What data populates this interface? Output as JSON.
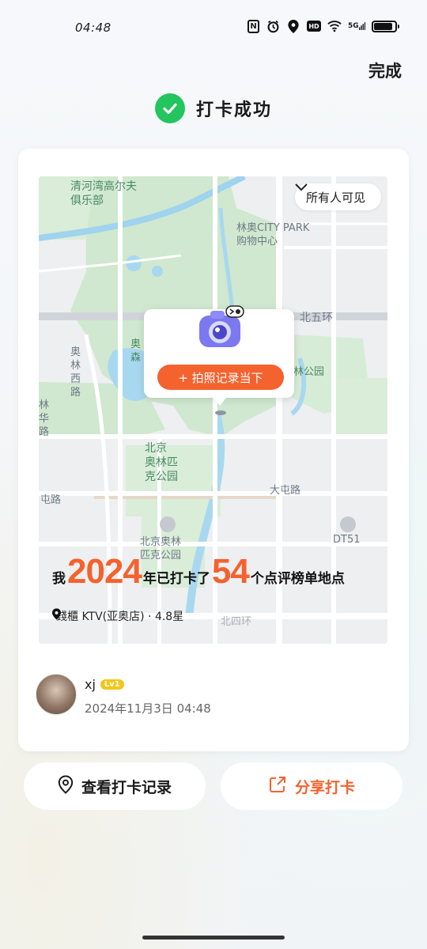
{
  "status_bar": {
    "time": "04:48",
    "icons": [
      "nfc-icon",
      "alarm-icon",
      "location-icon",
      "hd-icon",
      "wifi-icon",
      "5g-signal-icon",
      "battery-icon"
    ],
    "nfc": "N",
    "hd": "HD",
    "network": "5G",
    "battery_level": 0.9
  },
  "header": {
    "done_label": "完成",
    "success_text": "打卡成功"
  },
  "map": {
    "visibility_label": "所有人可见",
    "labels": {
      "club": "清河湾高尔夫\n俱乐部",
      "citypark": "林奥CITY PARK\n购物中心",
      "north5": "北五环",
      "park": "林公园",
      "forest": "奥\n森",
      "road1": "奥\n林\n西\n路",
      "road2": "林\n华\n路",
      "olympic": "北京\n奥林匹\n克公园",
      "datun": "大屯路",
      "datun2": "屯路",
      "olympic2": "北京奥林\n匹克公园",
      "dt51": "DT51",
      "north4": "北四环"
    },
    "popup_button": "+ 拍照记录当下"
  },
  "stats": {
    "prefix": "我",
    "year": "2024",
    "mid": "年已打卡了",
    "count": "54",
    "suffix": "个点评榜单地点"
  },
  "place": {
    "name": "錢櫃 KTV(亚奥店) · 4.8星"
  },
  "user": {
    "name": "xj",
    "level": "Lv1",
    "time": "2024年11月3日 04:48"
  },
  "actions": {
    "records_label": "查看打卡记录",
    "share_label": "分享打卡"
  },
  "colors": {
    "accent": "#f4622e",
    "success": "#22c55e",
    "level_badge": "#f5c518"
  }
}
